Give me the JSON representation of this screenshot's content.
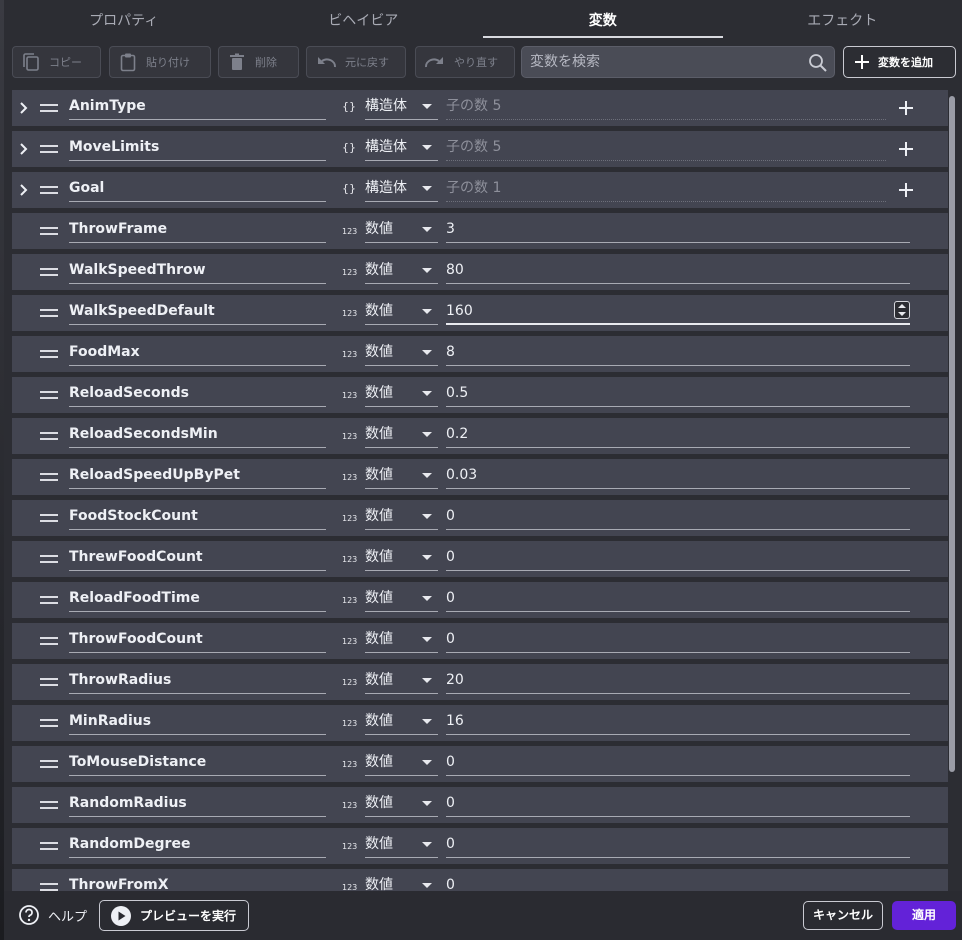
{
  "tabs": [
    {
      "label": "プロパティ",
      "active": false
    },
    {
      "label": "ビヘイビア",
      "active": false
    },
    {
      "label": "変数",
      "active": true
    },
    {
      "label": "エフェクト",
      "active": false
    }
  ],
  "toolbar": {
    "copy_label": "コピー",
    "paste_label": "貼り付け",
    "delete_label": "削除",
    "undo_label": "元に戻す",
    "redo_label": "やり直す",
    "search_placeholder": "変数を検索",
    "add_label": "変数を追加"
  },
  "icons": {
    "expand": "chevron-right-icon",
    "drag": "drag-handle-icon",
    "struct": "braces-icon",
    "number": "number-type-icon",
    "add": "plus-icon",
    "help": "help-circle-icon",
    "play": "play-icon",
    "search": "search-icon"
  },
  "struct_type_icon": "{}",
  "number_type_icon": "123",
  "variables": [
    {
      "name": "AnimType",
      "type": "構造体",
      "kind": "struct",
      "value": "子の数 5"
    },
    {
      "name": "MoveLimits",
      "type": "構造体",
      "kind": "struct",
      "value": "子の数 5"
    },
    {
      "name": "Goal",
      "type": "構造体",
      "kind": "struct",
      "value": "子の数 1"
    },
    {
      "name": "ThrowFrame",
      "type": "数値",
      "kind": "number",
      "value": "3"
    },
    {
      "name": "WalkSpeedThrow",
      "type": "数値",
      "kind": "number",
      "value": "80"
    },
    {
      "name": "WalkSpeedDefault",
      "type": "数値",
      "kind": "number",
      "value": "160",
      "focused": true
    },
    {
      "name": "FoodMax",
      "type": "数値",
      "kind": "number",
      "value": "8"
    },
    {
      "name": "ReloadSeconds",
      "type": "数値",
      "kind": "number",
      "value": "0.5"
    },
    {
      "name": "ReloadSecondsMin",
      "type": "数値",
      "kind": "number",
      "value": "0.2"
    },
    {
      "name": "ReloadSpeedUpByPet",
      "type": "数値",
      "kind": "number",
      "value": "0.03"
    },
    {
      "name": "FoodStockCount",
      "type": "数値",
      "kind": "number",
      "value": "0"
    },
    {
      "name": "ThrewFoodCount",
      "type": "数値",
      "kind": "number",
      "value": "0"
    },
    {
      "name": "ReloadFoodTime",
      "type": "数値",
      "kind": "number",
      "value": "0"
    },
    {
      "name": "ThrowFoodCount",
      "type": "数値",
      "kind": "number",
      "value": "0"
    },
    {
      "name": "ThrowRadius",
      "type": "数値",
      "kind": "number",
      "value": "20"
    },
    {
      "name": "MinRadius",
      "type": "数値",
      "kind": "number",
      "value": "16"
    },
    {
      "name": "ToMouseDistance",
      "type": "数値",
      "kind": "number",
      "value": "0"
    },
    {
      "name": "RandomRadius",
      "type": "数値",
      "kind": "number",
      "value": "0"
    },
    {
      "name": "RandomDegree",
      "type": "数値",
      "kind": "number",
      "value": "0"
    },
    {
      "name": "ThrowFromX",
      "type": "数値",
      "kind": "number",
      "value": "0"
    }
  ],
  "footer": {
    "help_label": "ヘルプ",
    "preview_label": "プレビューを実行",
    "cancel_label": "キャンセル",
    "apply_label": "適用"
  },
  "colors": {
    "accent": "#6322d8",
    "row_bg": "#434551",
    "panel_bg": "#2c2d33"
  }
}
